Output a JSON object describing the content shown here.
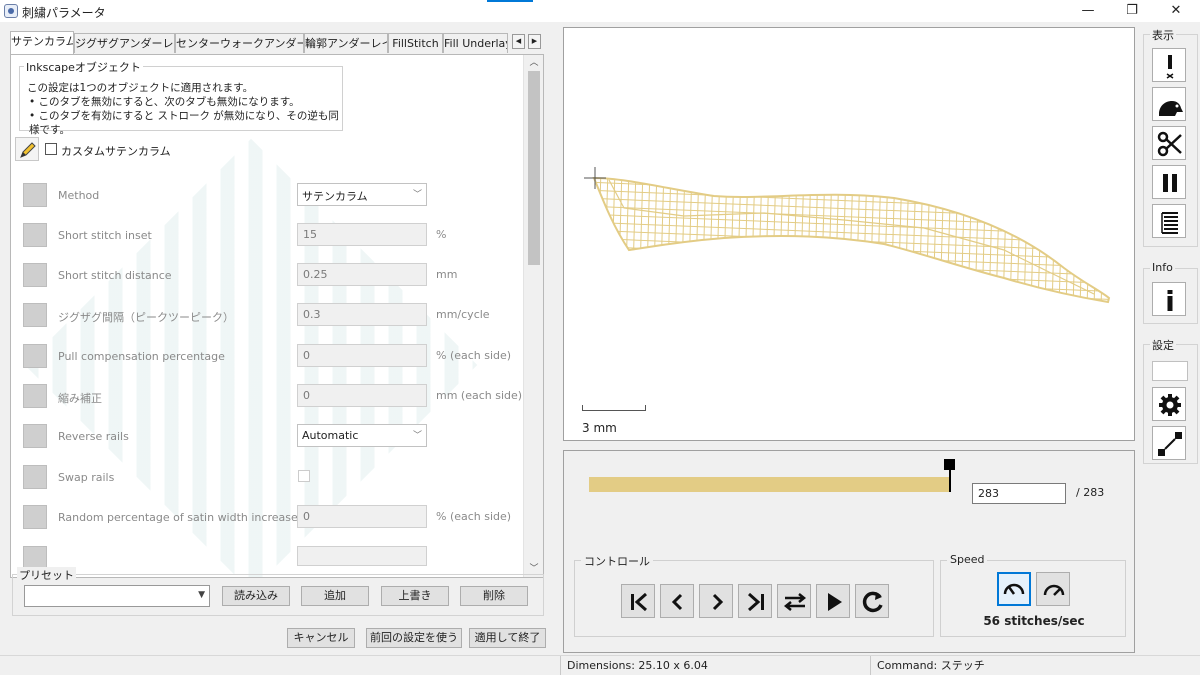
{
  "window": {
    "title": "刺繍パラメータ",
    "minimize": "—",
    "maximize": "❐",
    "close": "✕"
  },
  "tabs": {
    "items": [
      "サテンカラム",
      "ジグザグアンダーレイ",
      "センターウォークアンダーレイ",
      "輪郭アンダーレイ",
      "FillStitch",
      "Fill Underlay"
    ],
    "active": 0,
    "scroll_left": "◀",
    "scroll_right": "▶"
  },
  "inkscape_group": {
    "title": "Inkscapeオブジェクト",
    "lines": [
      "この設定は1つのオブジェクトに適用されます。",
      "• このタブを無効にすると、次のタブも無効になります。",
      "• このタブを有効にすると ストローク が無効になり、その逆も同様です。"
    ]
  },
  "custom": {
    "label": "カスタムサテンカラム",
    "checked": false
  },
  "params": [
    {
      "label": "Method",
      "value": "サテンカラム",
      "unit": "",
      "kind": "select"
    },
    {
      "label": "Short stitch inset",
      "value": "15",
      "unit": "%",
      "kind": "field"
    },
    {
      "label": "Short stitch distance",
      "value": "0.25",
      "unit": "mm",
      "kind": "field"
    },
    {
      "label": "ジグザグ間隔（ピークツーピーク）",
      "value": "0.3",
      "unit": "mm/cycle",
      "kind": "field"
    },
    {
      "label": "Pull compensation percentage",
      "value": "0",
      "unit": "% (each side)",
      "kind": "field"
    },
    {
      "label": "縮み補正",
      "value": "0",
      "unit": "mm (each side)",
      "kind": "field"
    },
    {
      "label": "Reverse rails",
      "value": "Automatic",
      "unit": "",
      "kind": "select"
    },
    {
      "label": "Swap rails",
      "value": "",
      "unit": "",
      "kind": "checkbox"
    },
    {
      "label": "Random percentage of satin width increase",
      "value": "0",
      "unit": "% (each side)",
      "kind": "field"
    }
  ],
  "presets": {
    "title": "プリセット",
    "selected": "",
    "load": "読み込み",
    "add": "追加",
    "overwrite": "上書き",
    "delete": "削除"
  },
  "footer_buttons": {
    "cancel": "キャンセル",
    "use_last": "前回の設定を使う",
    "apply_quit": "適用して終了"
  },
  "preview": {
    "scale_label": "3 mm",
    "stitch_color": "#e3cc85",
    "progress_fraction": 1.0,
    "current_stitch": "283",
    "total": "/ 283"
  },
  "controls": {
    "title": "コントロール",
    "buttons": [
      "skip-to-start-icon",
      "step-back-icon",
      "step-forward-icon",
      "skip-to-end-icon",
      "swap-direction-icon",
      "play-icon",
      "restart-icon"
    ]
  },
  "speed": {
    "title": "Speed",
    "value": "56 stitches/sec"
  },
  "sidebar": {
    "view_title": "表示",
    "info_title": "Info",
    "settings_title": "設定"
  },
  "status": {
    "dimensions": "Dimensions: 25.10 x 6.04",
    "command": "Command: ステッチ"
  }
}
